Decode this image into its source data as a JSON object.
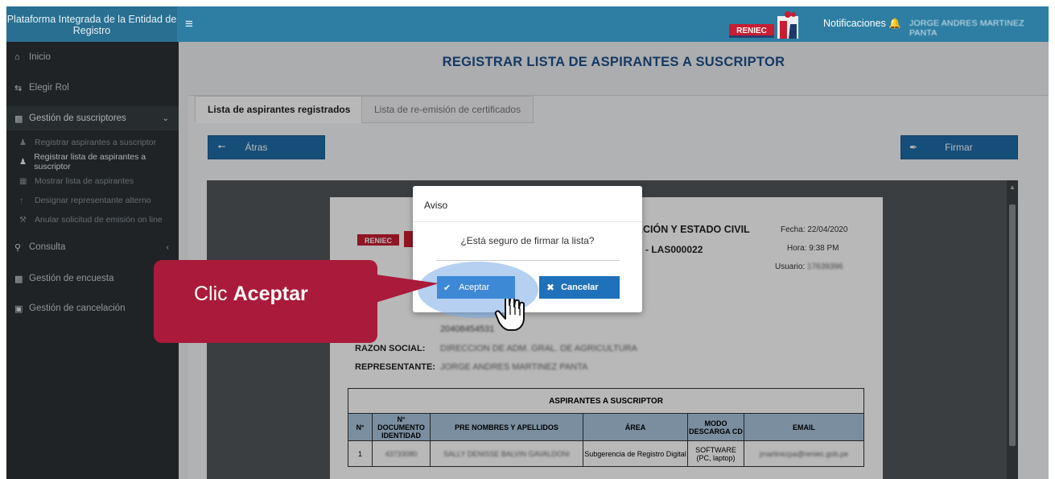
{
  "header": {
    "brand": "Plataforma Integrada de la Entidad de Registro",
    "logo_text": "RENIEC",
    "notifications_label": "Notificaciones",
    "username": "JORGE ANDRES MARTINEZ PANTA"
  },
  "sidebar": {
    "items": [
      {
        "label": "Inicio",
        "icon": "home-icon"
      },
      {
        "label": "Elegir Rol",
        "icon": "exchange-icon"
      },
      {
        "label": "Gestión de suscriptores",
        "icon": "address-card-icon"
      },
      {
        "label": "Consulta",
        "icon": "search-icon"
      },
      {
        "label": "Gestión de encuesta",
        "icon": "clipboard-icon"
      },
      {
        "label": "Gestión de cancelación",
        "icon": "cancel-icon"
      }
    ],
    "subitems": [
      {
        "label": "Registrar aspirantes a suscriptor"
      },
      {
        "label": "Registrar lista de aspirantes a suscriptor"
      },
      {
        "label": "Mostrar lista de aspirantes"
      },
      {
        "label": "Designar representante alterno"
      },
      {
        "label": "Anular solicitud de emisión on line"
      }
    ]
  },
  "main": {
    "title": "REGISTRAR LISTA DE ASPIRANTES A SUSCRIPTOR",
    "tabs": [
      {
        "label": "Lista de aspirantes registrados"
      },
      {
        "label": "Lista de re-emisión de certificados"
      }
    ],
    "back_label": "Átras",
    "sign_label": "Firmar"
  },
  "document": {
    "title_partial": "ACIÓN Y ESTADO CIVIL",
    "subtitle_partial": "R - LAS000022",
    "fecha": "Fecha: 22/04/2020",
    "hora": "Hora: 9:38 PM",
    "usuario_label": "Usuario:",
    "usuario_value": "17639396",
    "ruc": "20408454531",
    "razon_label": "RAZON SOCIAL:",
    "razon_value": "DIRECCION DE ADM. GRAL. DE AGRICULTURA",
    "rep_label": "REPRESENTANTE:",
    "rep_value": "JORGE ANDRES MARTINEZ PANTA",
    "table": {
      "caption": "ASPIRANTES A SUSCRIPTOR",
      "headers": [
        "N°",
        "N° DOCUMENTO IDENTIDAD",
        "PRE NOMBRES Y APELLIDOS",
        "ÁREA",
        "MODO DESCARGA CD",
        "EMAIL"
      ],
      "rows": [
        [
          "1",
          "43733080",
          "SALLY DENISSE BALVIN GAVALDONI",
          "Subgerencia de Registro Digital",
          "SOFTWARE (PC, laptop)",
          "jmartinezpa@reniec.gob.pe"
        ]
      ]
    }
  },
  "modal": {
    "title": "Aviso",
    "message": "¿Está seguro de firmar la lista?",
    "ok_label": "Aceptar",
    "cancel_label": "Cancelar"
  },
  "callout": {
    "prefix": "Clic",
    "emphasis": "Aceptar",
    "color": "#aa1a3a"
  }
}
